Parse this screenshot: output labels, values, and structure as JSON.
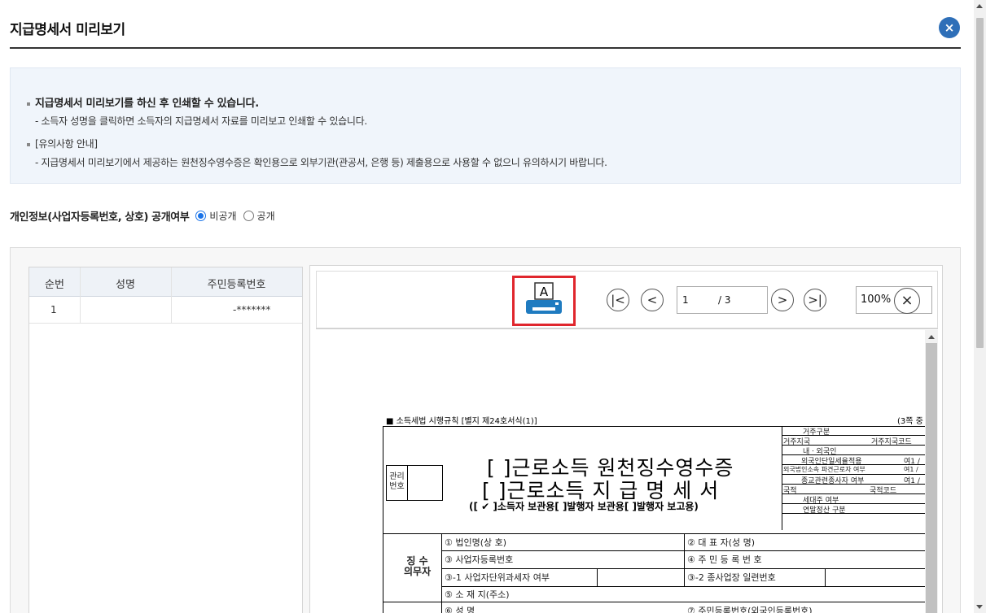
{
  "header": {
    "title": "지급명세서 미리보기",
    "close_label": "×"
  },
  "info": {
    "line1": "지급명세서 미리보기를 하신 후 인쇄할 수 있습니다.",
    "line2": "- 소득자 성명을 클릭하면 소득자의 지급명세서 자료를 미리보고 인쇄할 수 있습니다.",
    "line3": "[유의사항 안내]",
    "line4": "- 지급명세서 미리보기에서 제공하는 원천징수영수증은 확인용으로 외부기관(관공서, 은행 등) 제출용으로 사용할 수 없으니 유의하시기 바랍니다."
  },
  "privacy": {
    "label": "개인정보(사업자등록번호, 상호) 공개여부",
    "options": [
      "비공개",
      "공개"
    ],
    "selected": "비공개"
  },
  "list": {
    "columns": [
      "순번",
      "성명",
      "주민등록번호"
    ],
    "rows": [
      {
        "no": "1",
        "name": "",
        "rrn": "-*******"
      }
    ]
  },
  "viewer": {
    "print_icon": "printer-icon",
    "print_glyph": "A",
    "first_label": "|<",
    "prev_label": "<",
    "next_label": ">",
    "last_label": ">|",
    "page_current": "1",
    "page_total": "/ 3",
    "zoom": "100%",
    "zoom_close": "×",
    "accent": "#e0262d"
  },
  "document": {
    "law": "■ 소득세법 시행규칙 [별지 제24호서식(1)]",
    "page_note": "(3쪽 중",
    "mgmt_label": "관리\n번호",
    "heading1": "[  ]근로소득 원천징수영수증",
    "heading2": "[  ]근로소득 지 급 명 세 서",
    "sub": "([ ✔ ]소득자 보관용[    ]발행자 보관용[    ]발행자 보고용)",
    "right_table": [
      "거주구분",
      "거주지국",
      "거주지국코드",
      "내ㆍ외국인",
      "외국인단일세율적용",
      "외국법인소속 파견근로자 여부",
      "종교관련종사자 여부",
      "국적",
      "국적코드",
      "세대주 여부",
      "연말정산 구분",
      "여1 /",
      "여1 /",
      "여1 /"
    ],
    "payer_label": "징 수\n의무자",
    "fields": {
      "corp_name": "① 법인명(상 호)",
      "rep": "② 대 표 자(성 명)",
      "biz_no": "③ 사업자등록번호",
      "rrn": "④ 주 민 등 록 번 호",
      "unit_tax": "③-1 사업자단위과세자 여부",
      "branch": "③-2 종사업장 일련번호",
      "address": "⑤ 소 재 지(주소)",
      "name": "⑥ 성          명",
      "rrn2": "⑦ 주민등록번호(외국인등록번호)"
    }
  }
}
